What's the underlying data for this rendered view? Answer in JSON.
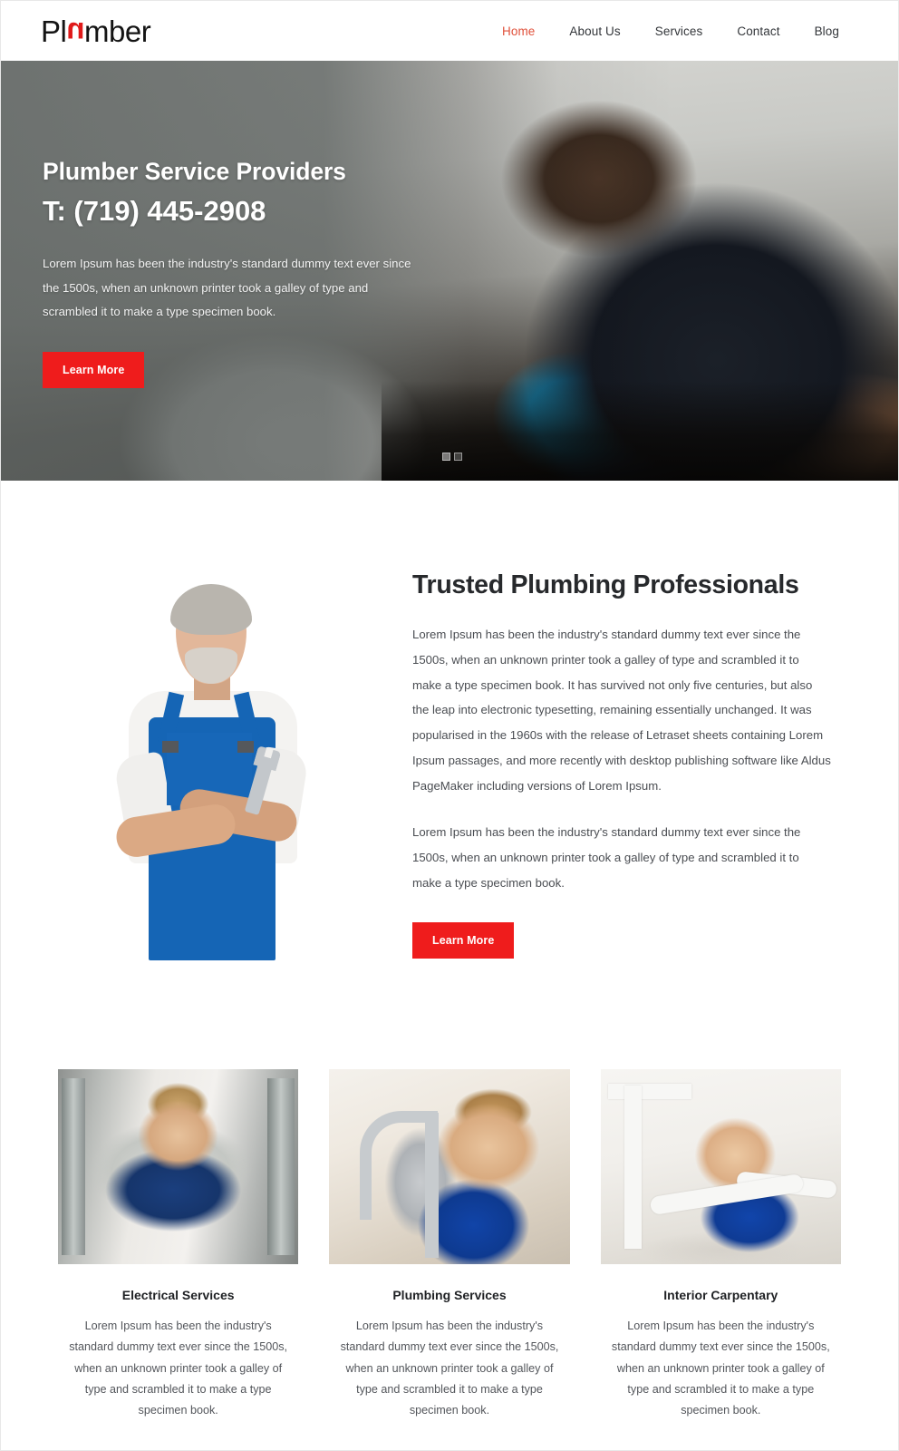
{
  "header": {
    "logo_prefix": "Pl",
    "logo_accent": "u",
    "logo_suffix": "mber",
    "nav": [
      {
        "label": "Home",
        "active": true
      },
      {
        "label": "About Us",
        "active": false
      },
      {
        "label": "Services",
        "active": false
      },
      {
        "label": "Contact",
        "active": false
      },
      {
        "label": "Blog",
        "active": false
      }
    ]
  },
  "hero": {
    "title": "Plumber Service Providers",
    "phone": "T: (719) 445-2908",
    "description": "Lorem Ipsum has been the industry's standard dummy text ever since the 1500s, when an unknown printer took a galley of type and scrambled it to make a type specimen book.",
    "cta_label": "Learn More",
    "slide_count": 2,
    "active_slide": 1
  },
  "about": {
    "image_alt": "plumber-portrait",
    "title": "Trusted Plumbing Professionals",
    "paragraph_1": "Lorem Ipsum has been the industry's standard dummy text ever since the 1500s, when an unknown printer took a galley of type and scrambled it to make a type specimen book. It has survived not only five centuries, but also the leap into electronic typesetting, remaining essentially unchanged. It was popularised in the 1960s with the release of Letraset sheets containing Lorem Ipsum passages, and more recently with desktop publishing software like Aldus PageMaker including versions of Lorem Ipsum.",
    "paragraph_2": "Lorem Ipsum has been the industry's standard dummy text ever since the 1500s, when an unknown printer took a galley of type and scrambled it to make a type specimen book.",
    "cta_label": "Learn More"
  },
  "services": [
    {
      "image_alt": "technician-repairing-dishwasher",
      "title": "Electrical Services",
      "text": "Lorem Ipsum has been the industry's standard dummy text ever since the 1500s, when an unknown printer took a galley of type and scrambled it to make a type specimen book."
    },
    {
      "image_alt": "plumber-fixing-kitchen-faucet",
      "title": "Plumbing Services",
      "text": "Lorem Ipsum has been the industry's standard dummy text ever since the 1500s, when an unknown printer took a galley of type and scrambled it to make a type specimen book."
    },
    {
      "image_alt": "plumber-under-sink-pipes",
      "title": "Interior Carpentary",
      "text": "Lorem Ipsum has been the industry's standard dummy text ever since the 1500s, when an unknown printer took a galley of type and scrambled it to make a type specimen book."
    }
  ],
  "colors": {
    "accent_red": "#ef1c1c",
    "nav_active": "#e0503a",
    "logo_accent": "#e01a1a",
    "heading": "#27292c",
    "body_text": "#4a4d52"
  }
}
